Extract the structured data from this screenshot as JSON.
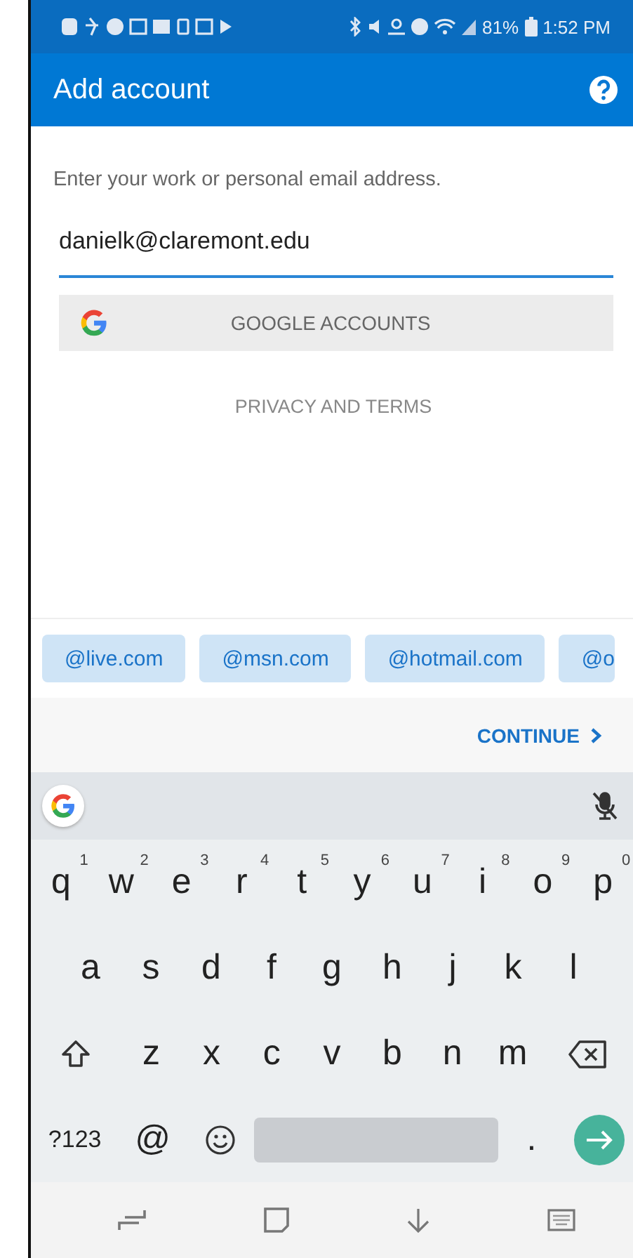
{
  "status_bar": {
    "battery": "81%",
    "time": "1:52 PM"
  },
  "app_bar": {
    "title": "Add account"
  },
  "form": {
    "prompt": "Enter your work or personal email address.",
    "email": "danielk@claremont.edu",
    "google_button": "GOOGLE ACCOUNTS",
    "privacy_link": "PRIVACY AND TERMS"
  },
  "domain_chips": [
    "@live.com",
    "@msn.com",
    "@hotmail.com",
    "@o"
  ],
  "continue_button": "CONTINUE",
  "keyboard": {
    "rows": [
      [
        {
          "kind": "char",
          "label": "q",
          "hint": "1"
        },
        {
          "kind": "char",
          "label": "w",
          "hint": "2"
        },
        {
          "kind": "char",
          "label": "e",
          "hint": "3"
        },
        {
          "kind": "char",
          "label": "r",
          "hint": "4"
        },
        {
          "kind": "char",
          "label": "t",
          "hint": "5"
        },
        {
          "kind": "char",
          "label": "y",
          "hint": "6"
        },
        {
          "kind": "char",
          "label": "u",
          "hint": "7"
        },
        {
          "kind": "char",
          "label": "i",
          "hint": "8"
        },
        {
          "kind": "char",
          "label": "o",
          "hint": "9"
        },
        {
          "kind": "char",
          "label": "p",
          "hint": "0"
        }
      ],
      [
        {
          "kind": "char",
          "label": "a"
        },
        {
          "kind": "char",
          "label": "s"
        },
        {
          "kind": "char",
          "label": "d"
        },
        {
          "kind": "char",
          "label": "f"
        },
        {
          "kind": "char",
          "label": "g"
        },
        {
          "kind": "char",
          "label": "h"
        },
        {
          "kind": "char",
          "label": "j"
        },
        {
          "kind": "char",
          "label": "k"
        },
        {
          "kind": "char",
          "label": "l"
        }
      ],
      [
        {
          "kind": "shift"
        },
        {
          "kind": "char",
          "label": "z"
        },
        {
          "kind": "char",
          "label": "x"
        },
        {
          "kind": "char",
          "label": "c"
        },
        {
          "kind": "char",
          "label": "v"
        },
        {
          "kind": "char",
          "label": "b"
        },
        {
          "kind": "char",
          "label": "n"
        },
        {
          "kind": "char",
          "label": "m"
        },
        {
          "kind": "backspace"
        }
      ],
      [
        {
          "kind": "symbols",
          "label": "?123"
        },
        {
          "kind": "char",
          "label": "@"
        },
        {
          "kind": "emoji"
        },
        {
          "kind": "space"
        },
        {
          "kind": "char",
          "label": "."
        },
        {
          "kind": "enter"
        }
      ]
    ]
  }
}
